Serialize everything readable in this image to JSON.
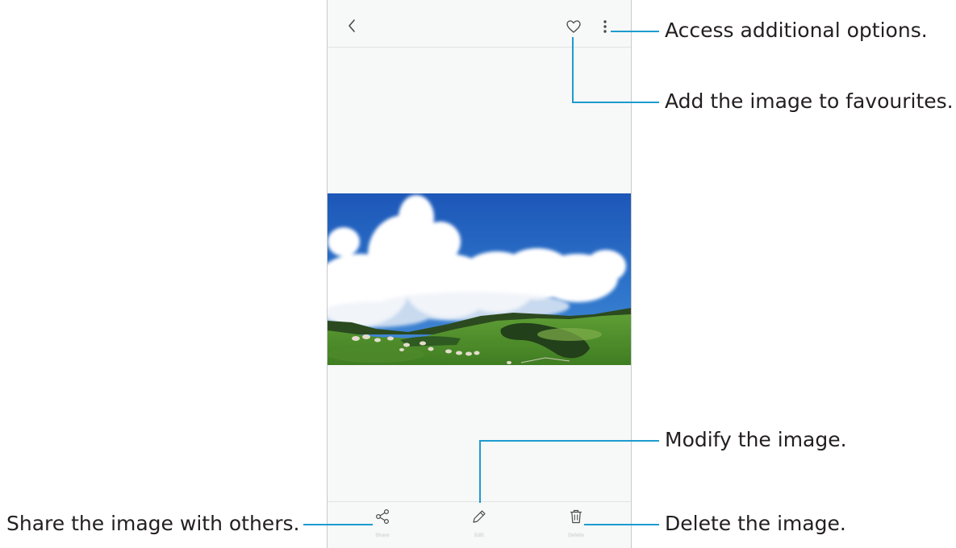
{
  "callouts": {
    "options": "Access additional options.",
    "favourite": "Add the image to favourites.",
    "modify": "Modify the image.",
    "share": "Share the image with others.",
    "delete": "Delete the image."
  },
  "toolbar": {
    "back_icon": "chevron-left-icon",
    "favourite_icon": "heart-outline-icon",
    "more_icon": "vertical-dots-icon"
  },
  "bottom_bar": {
    "share_label": "Share",
    "edit_label": "Edit",
    "delete_label": "Delete",
    "share_icon": "share-icon",
    "edit_icon": "pencil-icon",
    "delete_icon": "trash-icon"
  },
  "colors": {
    "accent_leader": "#1d9bcf",
    "screen_background": "#f7f8f8",
    "text": "#231f20"
  }
}
